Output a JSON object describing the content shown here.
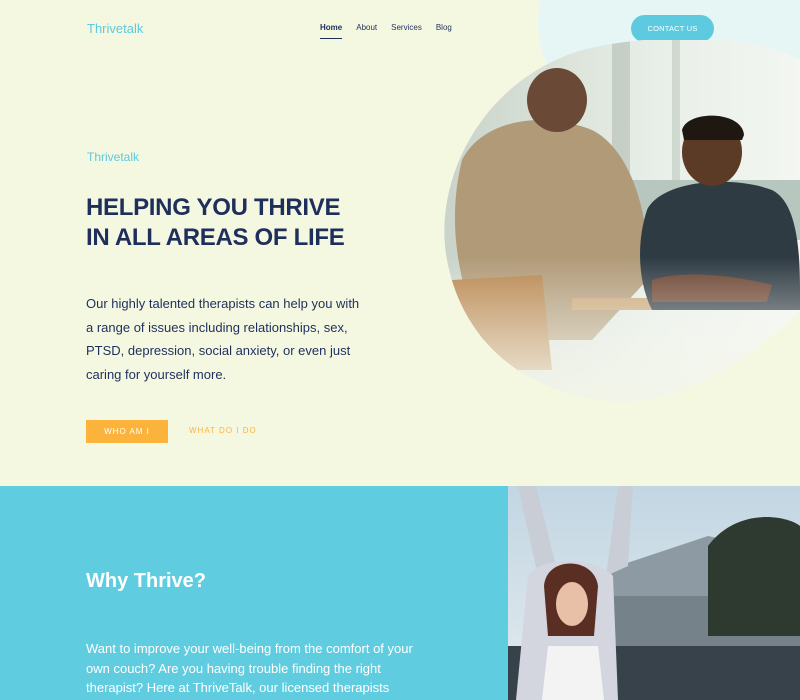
{
  "header": {
    "logo": "Thrivetalk",
    "nav": [
      "Home",
      "About",
      "Services",
      "Blog"
    ],
    "cta": "CONTACT US"
  },
  "hero": {
    "brand": "Thrivetalk",
    "title_line1": "HELPING YOU THRIVE",
    "title_line2": "IN ALL AREAS OF LIFE",
    "text": "Our highly talented therapists can help you with a range of issues including relationships, sex, PTSD, depression, social anxiety, or even just caring for yourself more.",
    "primary_button": "WHO AM I",
    "secondary_button": "WHAT DO I DO"
  },
  "why": {
    "title": "Why Thrive?",
    "text": "Want to improve your well-being from the comfort of your own couch? Are you having trouble finding the right therapist? Here at ThriveTalk, our licensed therapists"
  },
  "colors": {
    "hero_bg": "#f5f8e1",
    "accent_blue": "#5ecadf",
    "navy": "#1e2f5c",
    "orange": "#fbb33b"
  }
}
